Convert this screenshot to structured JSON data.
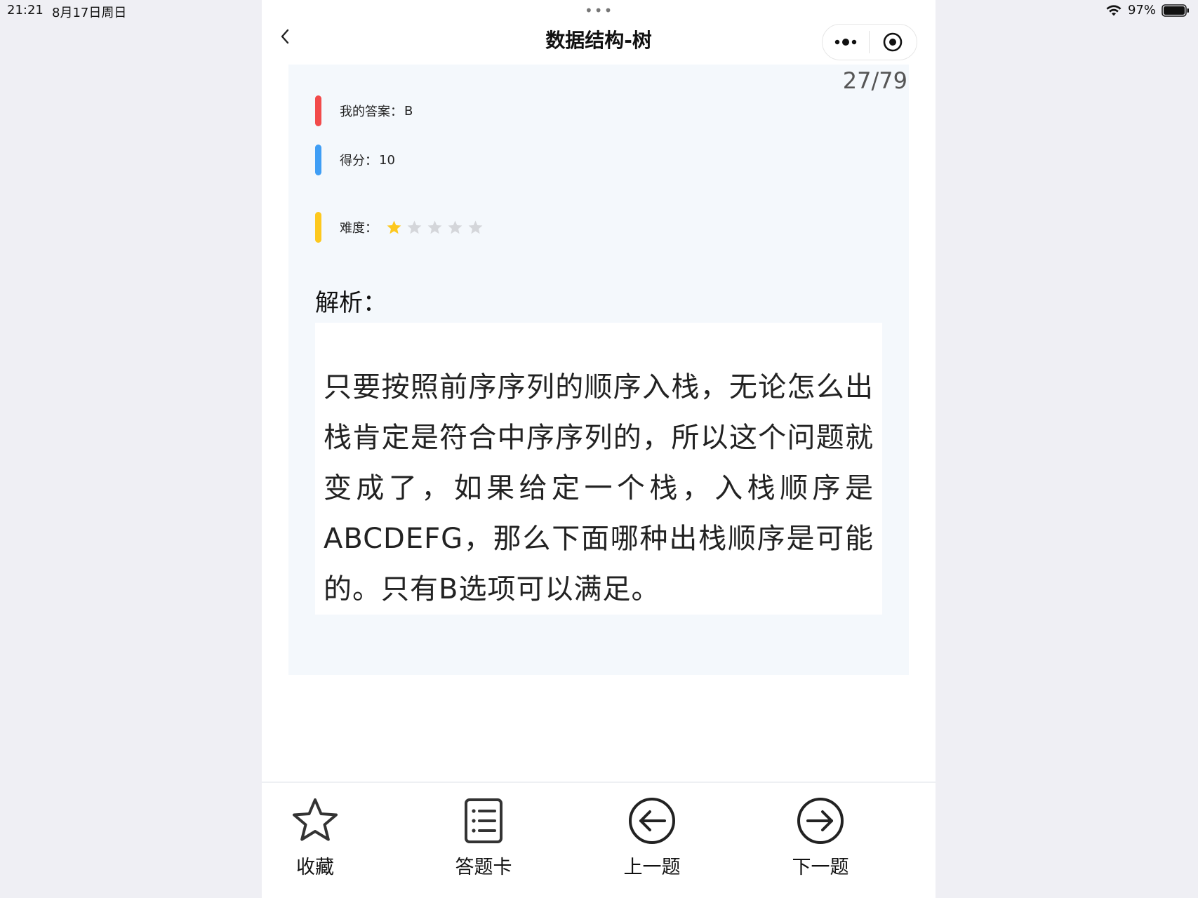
{
  "status_bar": {
    "time": "21:21",
    "date": "8月17日周日",
    "battery_percent": "97%"
  },
  "nav": {
    "title": "数据结构-树",
    "top_dots": "•••"
  },
  "card": {
    "counter": "27/79",
    "my_answer_label": "我的答案：",
    "my_answer_value": "B",
    "score_label": "得分：",
    "score_value": "10",
    "difficulty_label": "难度：",
    "difficulty_stars": 1,
    "difficulty_max": 5,
    "analysis_title": "解析：",
    "analysis_text": "只要按照前序序列的顺序入栈，无论怎么出栈肯定是符合中序序列的，所以这个问题就变成了，如果给定一个栈，入栈顺序是ABCDEFG，那么下面哪种出栈顺序是可能的。只有B选项可以满足。"
  },
  "colors": {
    "answer_bar": "#f24b4b",
    "score_bar": "#3f9ef5",
    "difficulty_bar": "#fdc81e",
    "star_filled": "#fdc81e",
    "star_empty": "#d4d6da"
  },
  "toolbar": {
    "favorite_label": "收藏",
    "answer_card_label": "答题卡",
    "prev_label": "上一题",
    "next_label": "下一题"
  }
}
